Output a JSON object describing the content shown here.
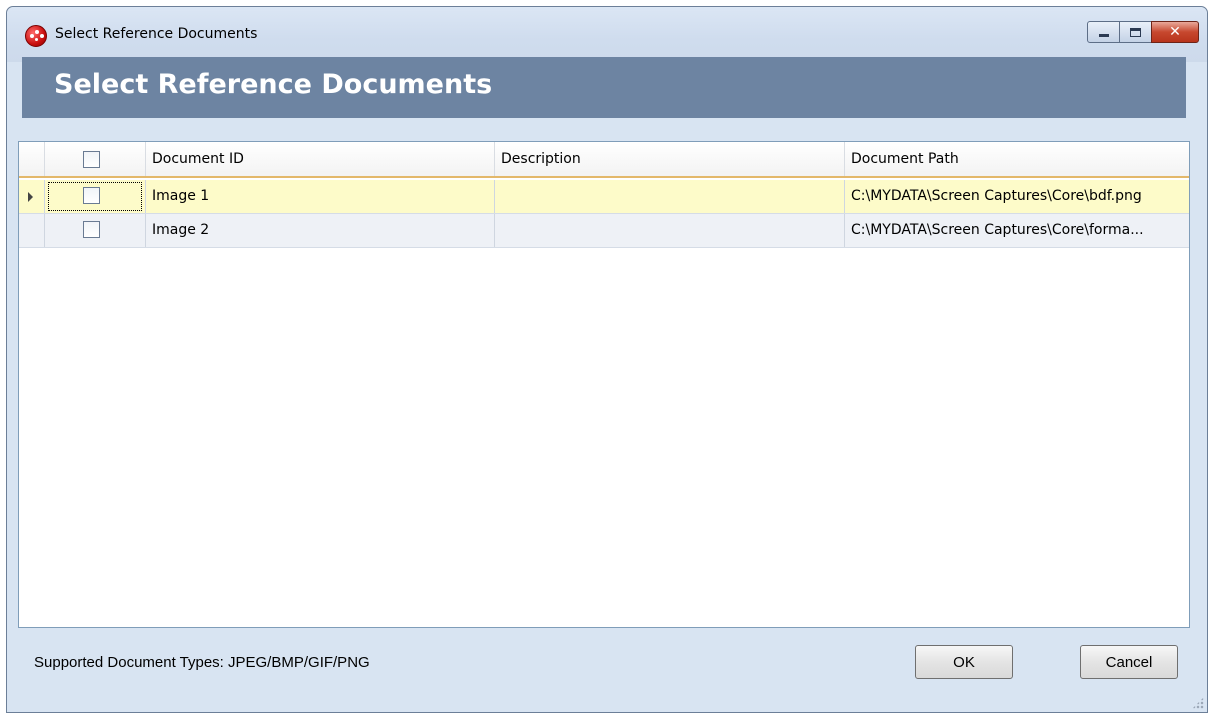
{
  "window": {
    "title": "Select Reference Documents",
    "controls": {
      "minimize": "minimize-icon",
      "maximize": "maximize-icon",
      "close": "close-icon",
      "close_glyph": "✕"
    }
  },
  "header": {
    "title": "Select Reference Documents",
    "band_color": "#6d84a2"
  },
  "grid": {
    "columns": [
      "Document ID",
      "Description",
      "Document Path"
    ],
    "rows": [
      {
        "checked": false,
        "document_id": "Image 1",
        "description": "",
        "document_path": "C:\\MYDATA\\Screen Captures\\Core\\bdf.png",
        "selected": true
      },
      {
        "checked": false,
        "document_id": "Image 2",
        "description": "",
        "document_path": "C:\\MYDATA\\Screen Captures\\Core\\forma...",
        "selected": false
      }
    ],
    "selected_row_color": "#fdfbc9",
    "alt_row_color": "#eef1f6"
  },
  "footer": {
    "supported_types": "Supported Document Types: JPEG/BMP/GIF/PNG",
    "ok_label": "OK",
    "cancel_label": "Cancel"
  }
}
